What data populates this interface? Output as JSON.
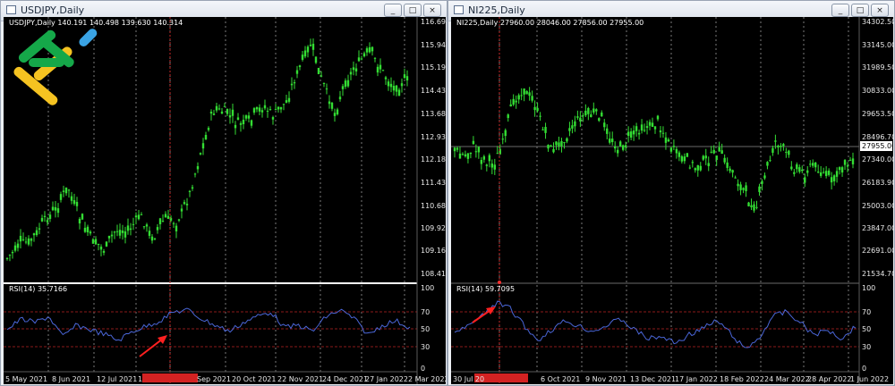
{
  "left_window": {
    "title": "USDJPY,Daily",
    "controls": {
      "minimize": "_",
      "maximize": "□",
      "close": "×"
    },
    "caption": "USDJPY,Daily  140.191 140.498 139.630 140.314",
    "rsi_label": "RSI(14) 35.7166",
    "price_axis": [
      "116.695",
      "115.945",
      "115.195",
      "114.430",
      "113.680",
      "112.930",
      "112.180",
      "111.430",
      "110.680",
      "109.920",
      "109.165",
      "108.415"
    ],
    "rsi_axis": [
      "100",
      "70",
      "50",
      "30",
      "0"
    ],
    "dates": [
      "5 May 2021",
      "8 Jun 2021",
      "12 Jul 2021",
      "1",
      "Sep 2021",
      "20 Oct 2021",
      "22 Nov 2021",
      "24 Dec 2021",
      "27 Jan 2022",
      "2 Mar 2022"
    ]
  },
  "right_window": {
    "title": "NI225,Daily",
    "controls": {
      "minimize": "_",
      "maximize": "□",
      "close": "×"
    },
    "caption": "NI225,Daily  27960.00 28046.00 27856.00 27955.00",
    "rsi_label": "RSI(14) 59.7095",
    "current_price": "27955.00",
    "price_axis": [
      "34302.50",
      "33145.00",
      "31989.50",
      "30833.00",
      "29653.50",
      "28496.70",
      "27340.00",
      "26183.90",
      "25003.00",
      "23847.00",
      "22691.00",
      "21534.70"
    ],
    "rsi_axis": [
      "100",
      "70",
      "50",
      "30",
      "0"
    ],
    "dates": [
      "30 Jul 20",
      "6 Oct 2021",
      "9 Nov 2021",
      "13 Dec 2021",
      "17 Jan 2022",
      "18 Feb 2022",
      "24 Mar 2022",
      "28 Apr 2022",
      "1 Jun 2022"
    ]
  },
  "colors": {
    "candle": "#33dd33",
    "rsi_line": "#4a66d8",
    "rsi_level": "#8b1a1a",
    "crosshair": "#c62828",
    "arrow": "#ff2020",
    "logo_green": "#15a849",
    "logo_yellow": "#f5c321",
    "logo_blue": "#3aa3e4"
  },
  "icons": [
    "window-icon",
    "minimize-icon",
    "maximize-icon",
    "close-icon",
    "red-arrow-icon",
    "brand-logo-icon"
  ]
}
